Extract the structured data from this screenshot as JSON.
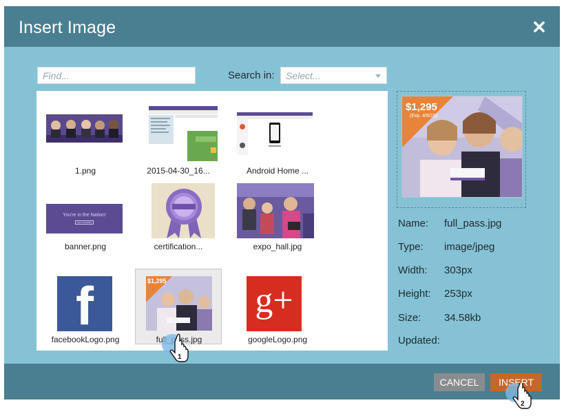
{
  "dialog": {
    "title": "Insert Image"
  },
  "search": {
    "placeholder": "Find...",
    "search_in_label": "Search in:",
    "select_value": "Select..."
  },
  "images": [
    {
      "name": "1.png"
    },
    {
      "name": "2015-04-30_16..."
    },
    {
      "name": "Android Home ..."
    },
    {
      "name": "banner.png",
      "thumb_text": "You're in the Nation!",
      "thumb_button": "GET STARTED"
    },
    {
      "name": "certification..."
    },
    {
      "name": "expo_hall.jpg"
    },
    {
      "name": "facebookLogo.png",
      "thumb_text": "f"
    },
    {
      "name": "full_pass.jpg",
      "price": "$1,295",
      "selected": true
    },
    {
      "name": "googleLogo.png",
      "thumb_text": "g+"
    }
  ],
  "preview": {
    "price": "$1,295",
    "price_note": "(Exp. 4/6/15)"
  },
  "details": {
    "name_label": "Name:",
    "name_value": "full_pass.jpg",
    "type_label": "Type:",
    "type_value": "image/jpeg",
    "width_label": "Width:",
    "width_value": "303px",
    "height_label": "Height:",
    "height_value": "253px",
    "size_label": "Size:",
    "size_value": "34.58kb",
    "updated_label": "Updated:",
    "updated_value": ""
  },
  "footer": {
    "cancel_label": "CANCEL",
    "insert_label": "INSERT"
  },
  "callouts": {
    "step1": "1",
    "step2": "2"
  },
  "colors": {
    "dialog_bg": "#86c2d5",
    "header_bg": "#4a7f91",
    "insert_button": "#c66729",
    "cancel_button": "#888c8e",
    "facebook_blue": "#3b5998",
    "google_red": "#d62d20",
    "price_orange": "#e8843a"
  }
}
